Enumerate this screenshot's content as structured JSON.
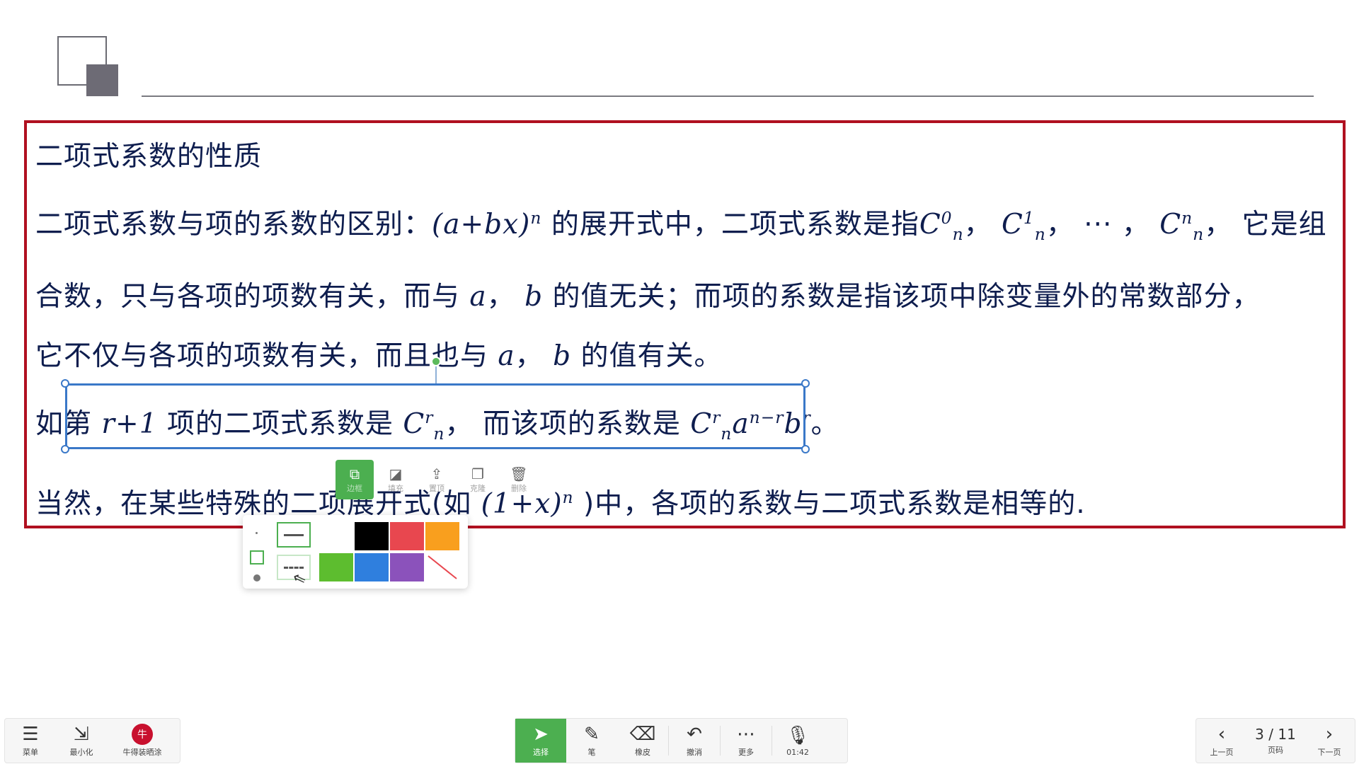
{
  "slide": {
    "title": "二项式系数的性质",
    "line2": {
      "a": "二项式系数与项的系数的区别：",
      "expr": "(a+bx)",
      "exp": "n",
      "b": " 的展开式中，二项式系数是指",
      "c0": "C",
      "c0sup": "0",
      "c0sub": "n",
      "sep1": "， ",
      "c1": "C",
      "c1sup": "1",
      "c1sub": "n",
      "sep2": "， ··· ， ",
      "cn": "C",
      "cnsup": "n",
      "cnsub": "n",
      "c": "， 它是组"
    },
    "line3": {
      "a": "合数，只与各项的项数有关，而与 ",
      "va": "a",
      "b": "， ",
      "vb": "b",
      "c": " 的值无关；而项的系数是指该项中除变量外的常数部分，"
    },
    "line4": {
      "a": "它不仅与各项的项数有关，而且也与 ",
      "va": "a",
      "b": "， ",
      "vb": "b",
      "c": " 的值有关。"
    },
    "line5": {
      "a": "如第 ",
      "r1": "r+1",
      "b": " 项的二项式系数是 ",
      "cr": "C",
      "crsup": "r",
      "crsub": "n",
      "c": "， 而该项的系数是 ",
      "cr2": "C",
      "cr2sup": "r",
      "cr2sub": "n",
      "aa": "a",
      "aexp": "n−r",
      "bb": "b",
      "bexp": "r",
      "d": "。"
    },
    "line6": {
      "a": "当然，在某些特殊的二项展开式(如 ",
      "expr": "(1+x)",
      "exp": "n",
      "b": " )中，各项的系数与二项式系数是相等的."
    }
  },
  "object_toolbar": {
    "items": [
      {
        "label": "边框",
        "icon": "border-icon"
      },
      {
        "label": "填充",
        "icon": "fill-icon"
      },
      {
        "label": "置顶",
        "icon": "bring-front-icon"
      },
      {
        "label": "克隆",
        "icon": "clone-icon"
      },
      {
        "label": "删除",
        "icon": "delete-icon"
      }
    ]
  },
  "style_popup": {
    "colors": [
      "#ffffff",
      "#000000",
      "#e8474f",
      "#f99f1e",
      "#5dbd2f",
      "#2f7fde",
      "#8b52bb",
      "none"
    ]
  },
  "bottom_left": {
    "menu_label": "菜单",
    "minimize_label": "最小化",
    "app_label": "牛得装晒涂"
  },
  "bottom_center": {
    "select_label": "选择",
    "pen_label": "笔",
    "eraser_label": "橡皮",
    "undo_label": "撤消",
    "more_label": "更多",
    "mic_label": "01:42"
  },
  "bottom_right": {
    "prev_label": "上一页",
    "page_indicator": "3 / 11",
    "page_label": "页码",
    "next_label": "下一页"
  },
  "colors": {
    "accent": "#4caf50",
    "frame": "#b01020",
    "selection": "#3a78c8",
    "text": "#0e1d4e"
  }
}
